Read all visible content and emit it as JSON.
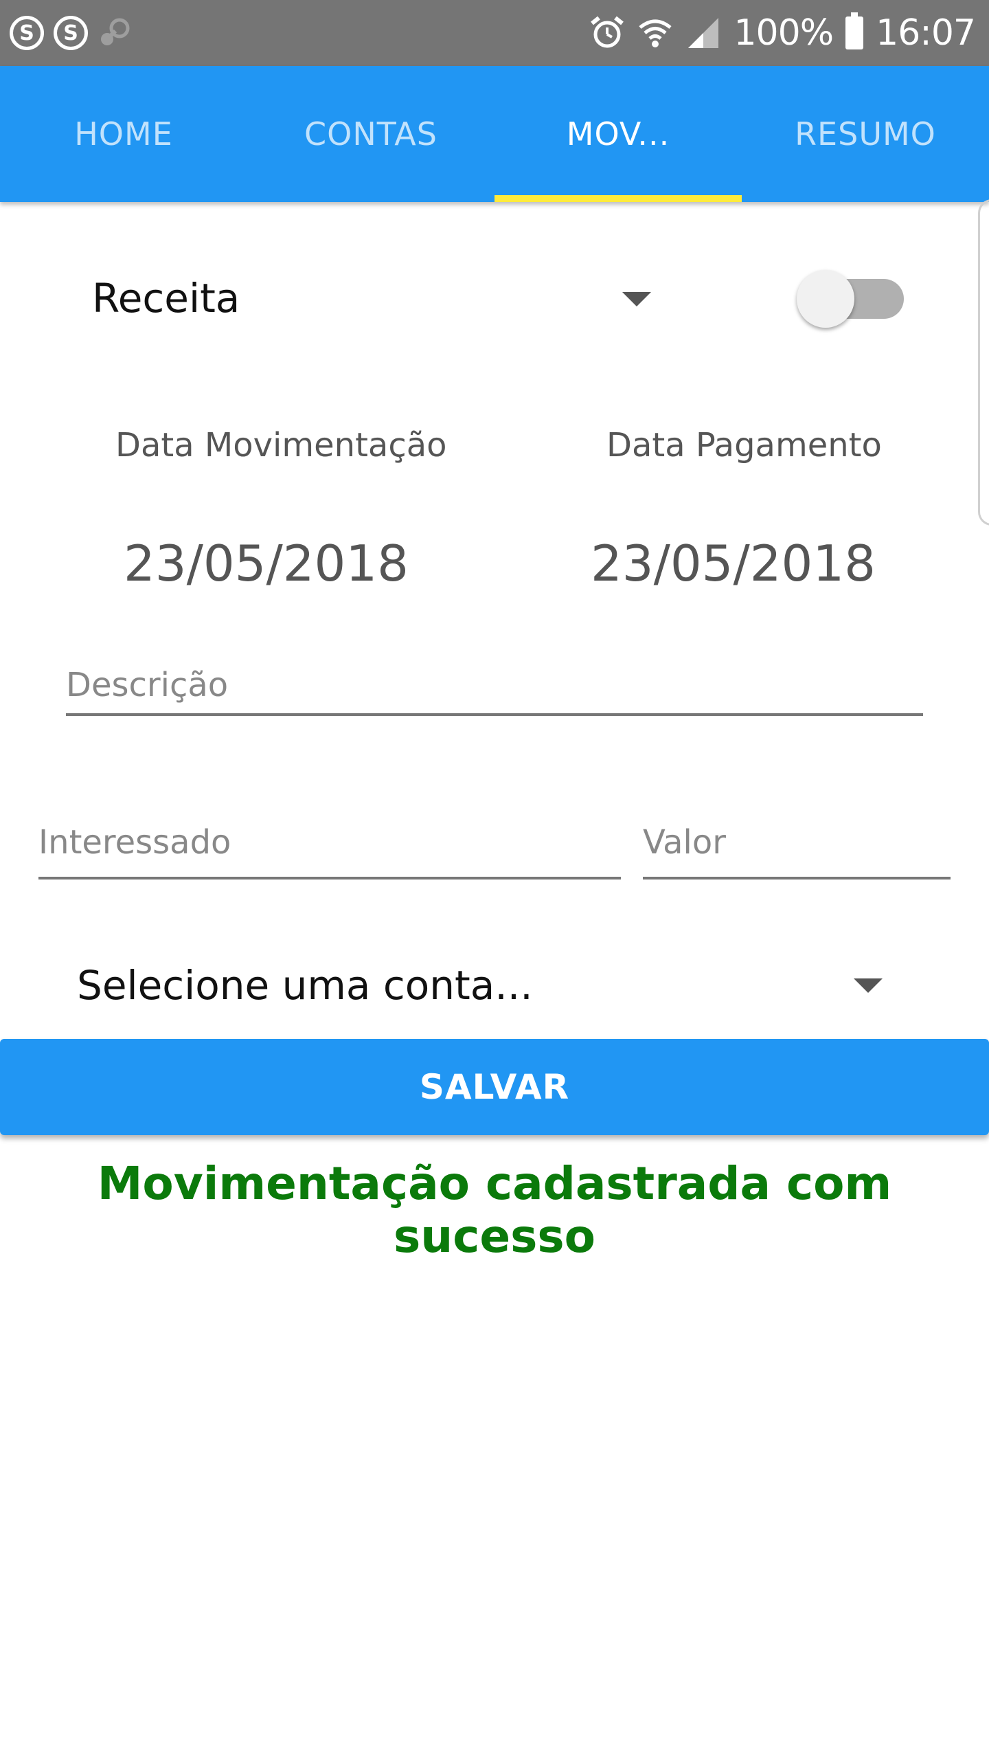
{
  "status_bar": {
    "left_icons": [
      "skype-icon",
      "skype-icon",
      "steam-icon"
    ],
    "right_icons": [
      "alarm-icon",
      "wifi-icon",
      "signal-icon",
      "battery-icon"
    ],
    "battery": "100%",
    "time": "16:07"
  },
  "tabs": [
    {
      "label": "HOME",
      "active": false
    },
    {
      "label": "CONTAS",
      "active": false
    },
    {
      "label": "MOV...",
      "active": true
    },
    {
      "label": "RESUMO",
      "active": false
    }
  ],
  "form": {
    "type_selected": "Receita",
    "type_switch_on": false,
    "date_movimentacao_label": "Data Movimentação",
    "date_movimentacao_value": "23/05/2018",
    "date_pagamento_label": "Data Pagamento",
    "date_pagamento_value": "23/05/2018",
    "descricao_placeholder": "Descrição",
    "interessado_placeholder": "Interessado",
    "valor_placeholder": "Valor",
    "account_selected": "Selecione uma conta...",
    "save_label": "SALVAR"
  },
  "message": "Movimentação cadastrada com sucesso",
  "colors": {
    "status_bar": "#757575",
    "primary": "#2196f3",
    "tab_indicator": "#ffeb3b",
    "success": "#0b7a0b"
  }
}
